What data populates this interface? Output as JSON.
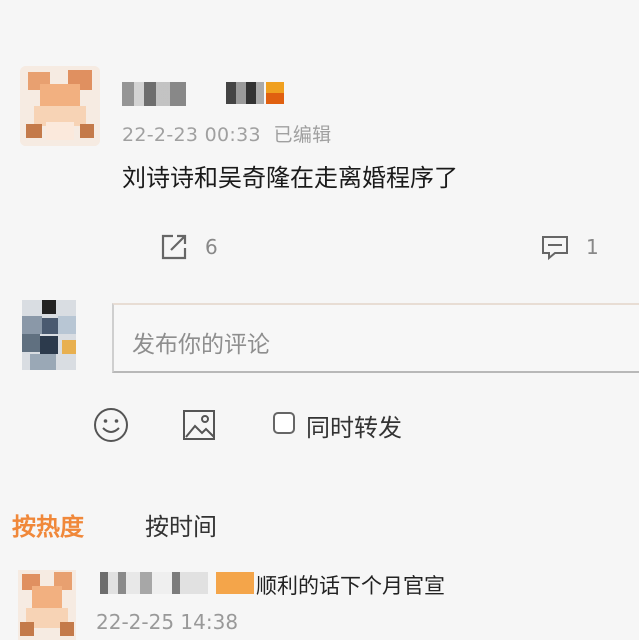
{
  "post": {
    "timestamp": "22-2-23 00:33",
    "edited_label": "已编辑",
    "text": "刘诗诗和吴奇隆在走离婚程序了",
    "share_count": "6",
    "comment_count": "1"
  },
  "composer": {
    "placeholder": "发布你的评论",
    "repost_label": "同时转发"
  },
  "sort_tabs": {
    "hot": "按热度",
    "time": "按时间"
  },
  "reply": {
    "text": "顺利的话下个月官宣",
    "timestamp": "22-2-25 14:38"
  },
  "colors": {
    "background": "#f6f6f6",
    "accent": "#f0883a"
  },
  "icons": [
    "share-icon",
    "comment-icon",
    "emoji-icon",
    "image-icon"
  ]
}
